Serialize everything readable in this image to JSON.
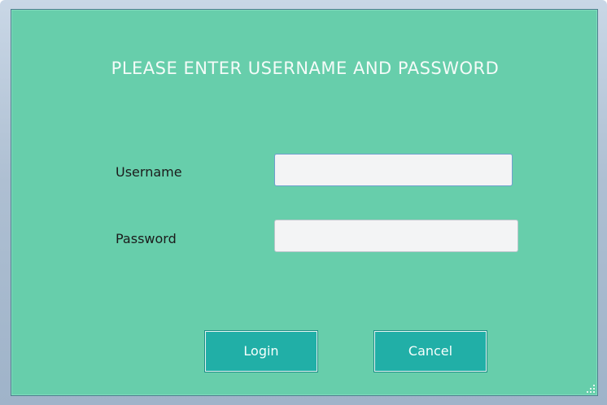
{
  "dialog": {
    "heading": "PLEASE ENTER USERNAME AND PASSWORD"
  },
  "form": {
    "username_label": "Username",
    "username_value": "",
    "username_placeholder": "",
    "password_label": "Password",
    "password_value": "",
    "password_placeholder": ""
  },
  "buttons": {
    "login_label": "Login",
    "cancel_label": "Cancel"
  },
  "colors": {
    "background": "#67ceab",
    "button": "#21afa7",
    "heading_text": "#f4fbf8"
  },
  "icons": {
    "resize_grip": "resize-grip-icon"
  }
}
